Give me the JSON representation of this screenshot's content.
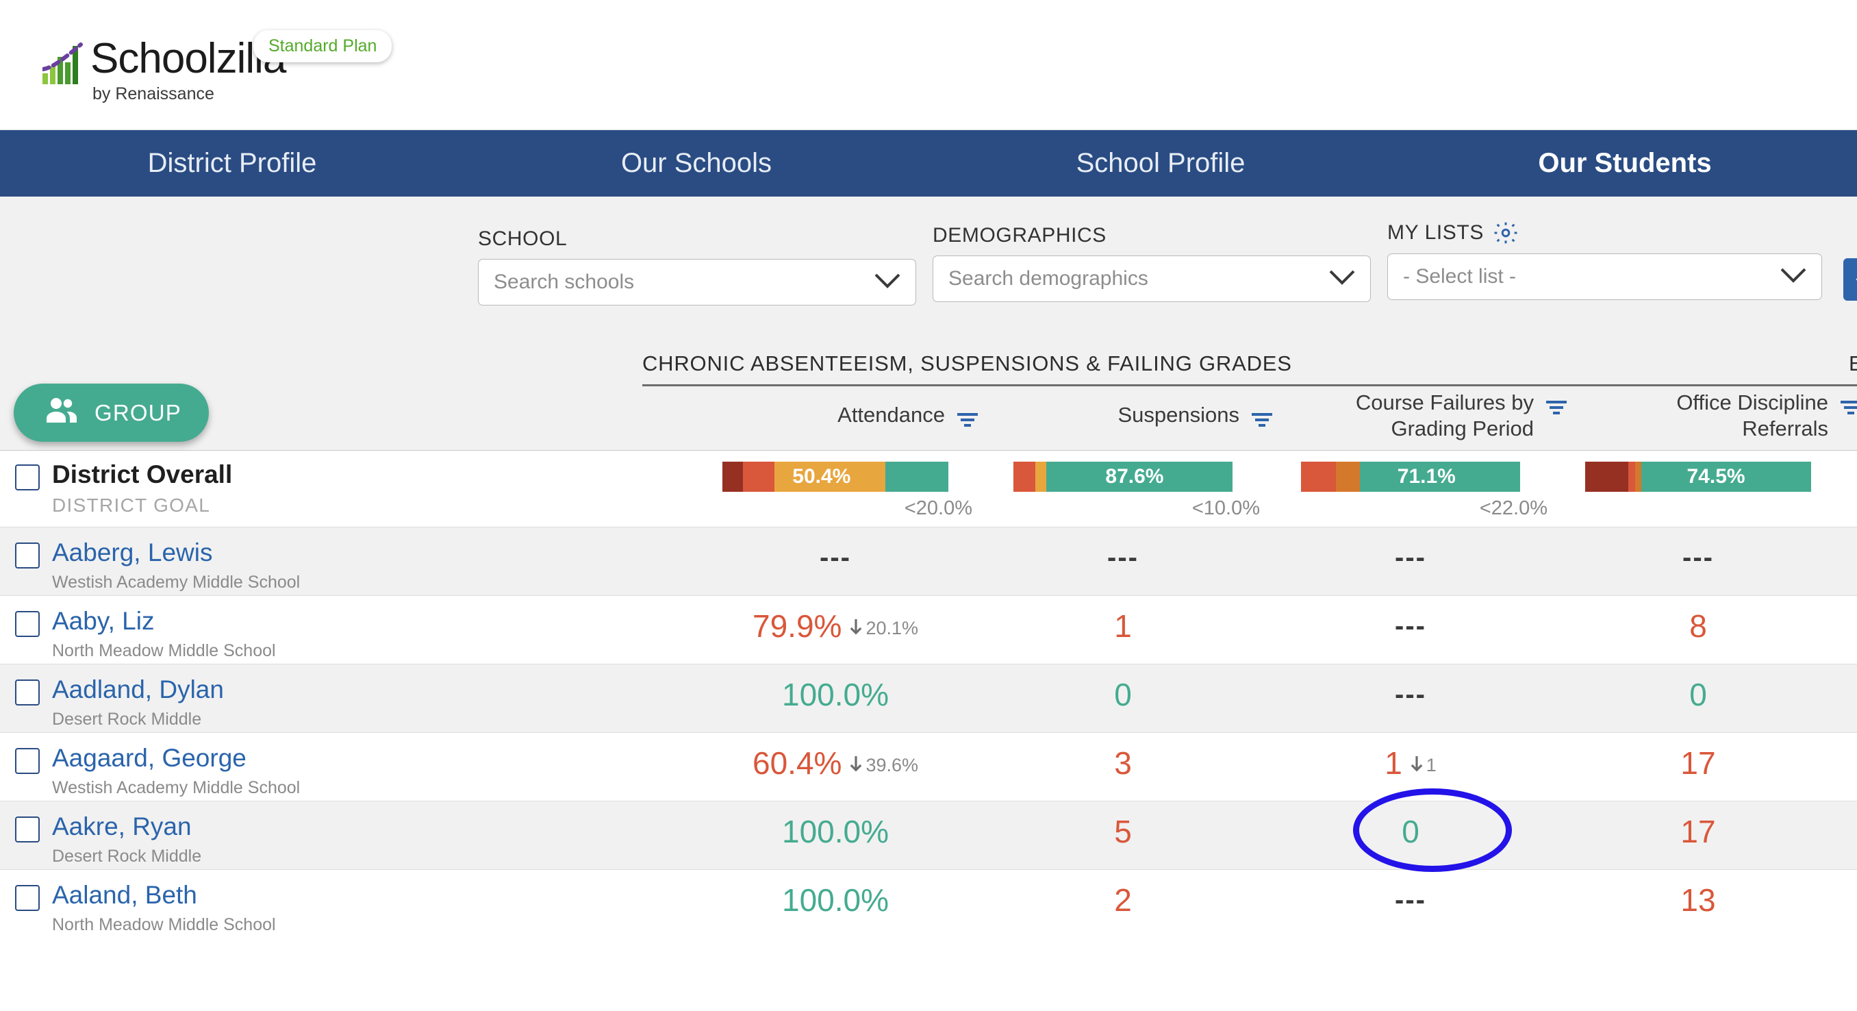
{
  "brand": {
    "name": "Schoolzilla",
    "tagline": "by Renaissance",
    "plan_badge": "Standard Plan",
    "badge_color": "#54aa2a",
    "logo_icon": "bar-chart-logo-icon"
  },
  "nav": {
    "items": [
      {
        "label": "District Profile",
        "active": false
      },
      {
        "label": "Our Schools",
        "active": false
      },
      {
        "label": "School Profile",
        "active": false
      },
      {
        "label": "Our Students",
        "active": true
      }
    ],
    "background": "#2a4c83"
  },
  "filters": {
    "school": {
      "label": "SCHOOL",
      "placeholder": "Search schools",
      "value": ""
    },
    "demographics": {
      "label": "DEMOGRAPHICS",
      "placeholder": "Search demographics",
      "value": ""
    },
    "my_lists": {
      "label": "MY LISTS",
      "placeholder": "- Select list -",
      "value": "",
      "gear_icon": "gear-icon"
    },
    "download_button": {
      "icon": "download-icon",
      "color": "#2e64ab"
    }
  },
  "toolbar": {
    "group_button": {
      "label": "GROUP",
      "icon": "people-icon",
      "color": "#45ab90"
    }
  },
  "table": {
    "sections": [
      {
        "title": "CHRONIC ABSENTEEISM, SUSPENSIONS & FAILING GRADES"
      },
      {
        "title": "E"
      }
    ],
    "columns": [
      {
        "label": "Attendance",
        "filter_icon": "filter-icon"
      },
      {
        "label": "Suspensions",
        "filter_icon": "filter-icon"
      },
      {
        "label": "Course Failures by Grading Period",
        "filter_icon": "filter-icon"
      },
      {
        "label": "Office Discipline Referrals",
        "filter_icon": "filter-icon"
      }
    ],
    "district_row": {
      "name": "District Overall",
      "sub": "DISTRICT GOAL",
      "cells": [
        {
          "label": "50.4%",
          "goal": "<20.0%",
          "segments": [
            {
              "color": "#963023",
              "pct": 9
            },
            {
              "color": "#d9573a",
              "pct": 14
            },
            {
              "color": "#e8a63f",
              "pct": 49
            },
            {
              "color": "#45ab90",
              "pct": 28
            }
          ]
        },
        {
          "label": "87.6%",
          "goal": "<10.0%",
          "segments": [
            {
              "color": "#d9573a",
              "pct": 10
            },
            {
              "color": "#e8a63f",
              "pct": 5
            },
            {
              "color": "#45ab90",
              "pct": 85
            }
          ]
        },
        {
          "label": "71.1%",
          "goal": "<22.0%",
          "segments": [
            {
              "color": "#d9573a",
              "pct": 16
            },
            {
              "color": "#d4792b",
              "pct": 11
            },
            {
              "color": "#45ab90",
              "pct": 73
            }
          ]
        },
        {
          "label": "74.5%",
          "goal": "",
          "segments": [
            {
              "color": "#963023",
              "pct": 19
            },
            {
              "color": "#d9573a",
              "pct": 3
            },
            {
              "color": "#d4792b",
              "pct": 3
            },
            {
              "color": "#45ab90",
              "pct": 75
            }
          ]
        }
      ]
    },
    "rows": [
      {
        "name": "Aaberg, Lewis",
        "school": "Westish Academy Middle School",
        "shaded": true,
        "cells": [
          {
            "value": "---",
            "tone": "dash",
            "delta": ""
          },
          {
            "value": "---",
            "tone": "dash",
            "delta": ""
          },
          {
            "value": "---",
            "tone": "dash",
            "delta": ""
          },
          {
            "value": "---",
            "tone": "dash",
            "delta": ""
          }
        ]
      },
      {
        "name": "Aaby, Liz",
        "school": "North Meadow Middle School",
        "shaded": false,
        "cells": [
          {
            "value": "79.9%",
            "tone": "red",
            "delta": "20.1%"
          },
          {
            "value": "1",
            "tone": "red",
            "delta": ""
          },
          {
            "value": "---",
            "tone": "dash",
            "delta": ""
          },
          {
            "value": "8",
            "tone": "red",
            "delta": ""
          }
        ]
      },
      {
        "name": "Aadland, Dylan",
        "school": "Desert Rock Middle",
        "shaded": true,
        "cells": [
          {
            "value": "100.0%",
            "tone": "green",
            "delta": ""
          },
          {
            "value": "0",
            "tone": "green",
            "delta": ""
          },
          {
            "value": "---",
            "tone": "dash",
            "delta": ""
          },
          {
            "value": "0",
            "tone": "green",
            "delta": ""
          }
        ]
      },
      {
        "name": "Aagaard, George",
        "school": "Westish Academy Middle School",
        "shaded": false,
        "cells": [
          {
            "value": "60.4%",
            "tone": "red",
            "delta": "39.6%"
          },
          {
            "value": "3",
            "tone": "red",
            "delta": ""
          },
          {
            "value": "1",
            "tone": "red",
            "delta": "1",
            "annotated": true
          },
          {
            "value": "17",
            "tone": "red",
            "delta": ""
          }
        ]
      },
      {
        "name": "Aakre, Ryan",
        "school": "Desert Rock Middle",
        "shaded": true,
        "cells": [
          {
            "value": "100.0%",
            "tone": "green",
            "delta": ""
          },
          {
            "value": "5",
            "tone": "red",
            "delta": ""
          },
          {
            "value": "0",
            "tone": "green",
            "delta": ""
          },
          {
            "value": "17",
            "tone": "red",
            "delta": ""
          }
        ]
      },
      {
        "name": "Aaland, Beth",
        "school": "North Meadow Middle School",
        "shaded": false,
        "cells": [
          {
            "value": "100.0%",
            "tone": "green",
            "delta": ""
          },
          {
            "value": "2",
            "tone": "red",
            "delta": ""
          },
          {
            "value": "---",
            "tone": "dash",
            "delta": ""
          },
          {
            "value": "13",
            "tone": "red",
            "delta": ""
          }
        ]
      }
    ]
  },
  "annotation": {
    "shape": "ellipse",
    "color": "#2313e8",
    "target": "course-failures-aagaard-george"
  },
  "colors": {
    "nav": "#2a4c83",
    "link": "#2a64ab",
    "red": "#d9573a",
    "dark_red": "#963023",
    "orange": "#e8a63f",
    "green": "#45ab90",
    "filter_bg": "#f1f1f1"
  }
}
